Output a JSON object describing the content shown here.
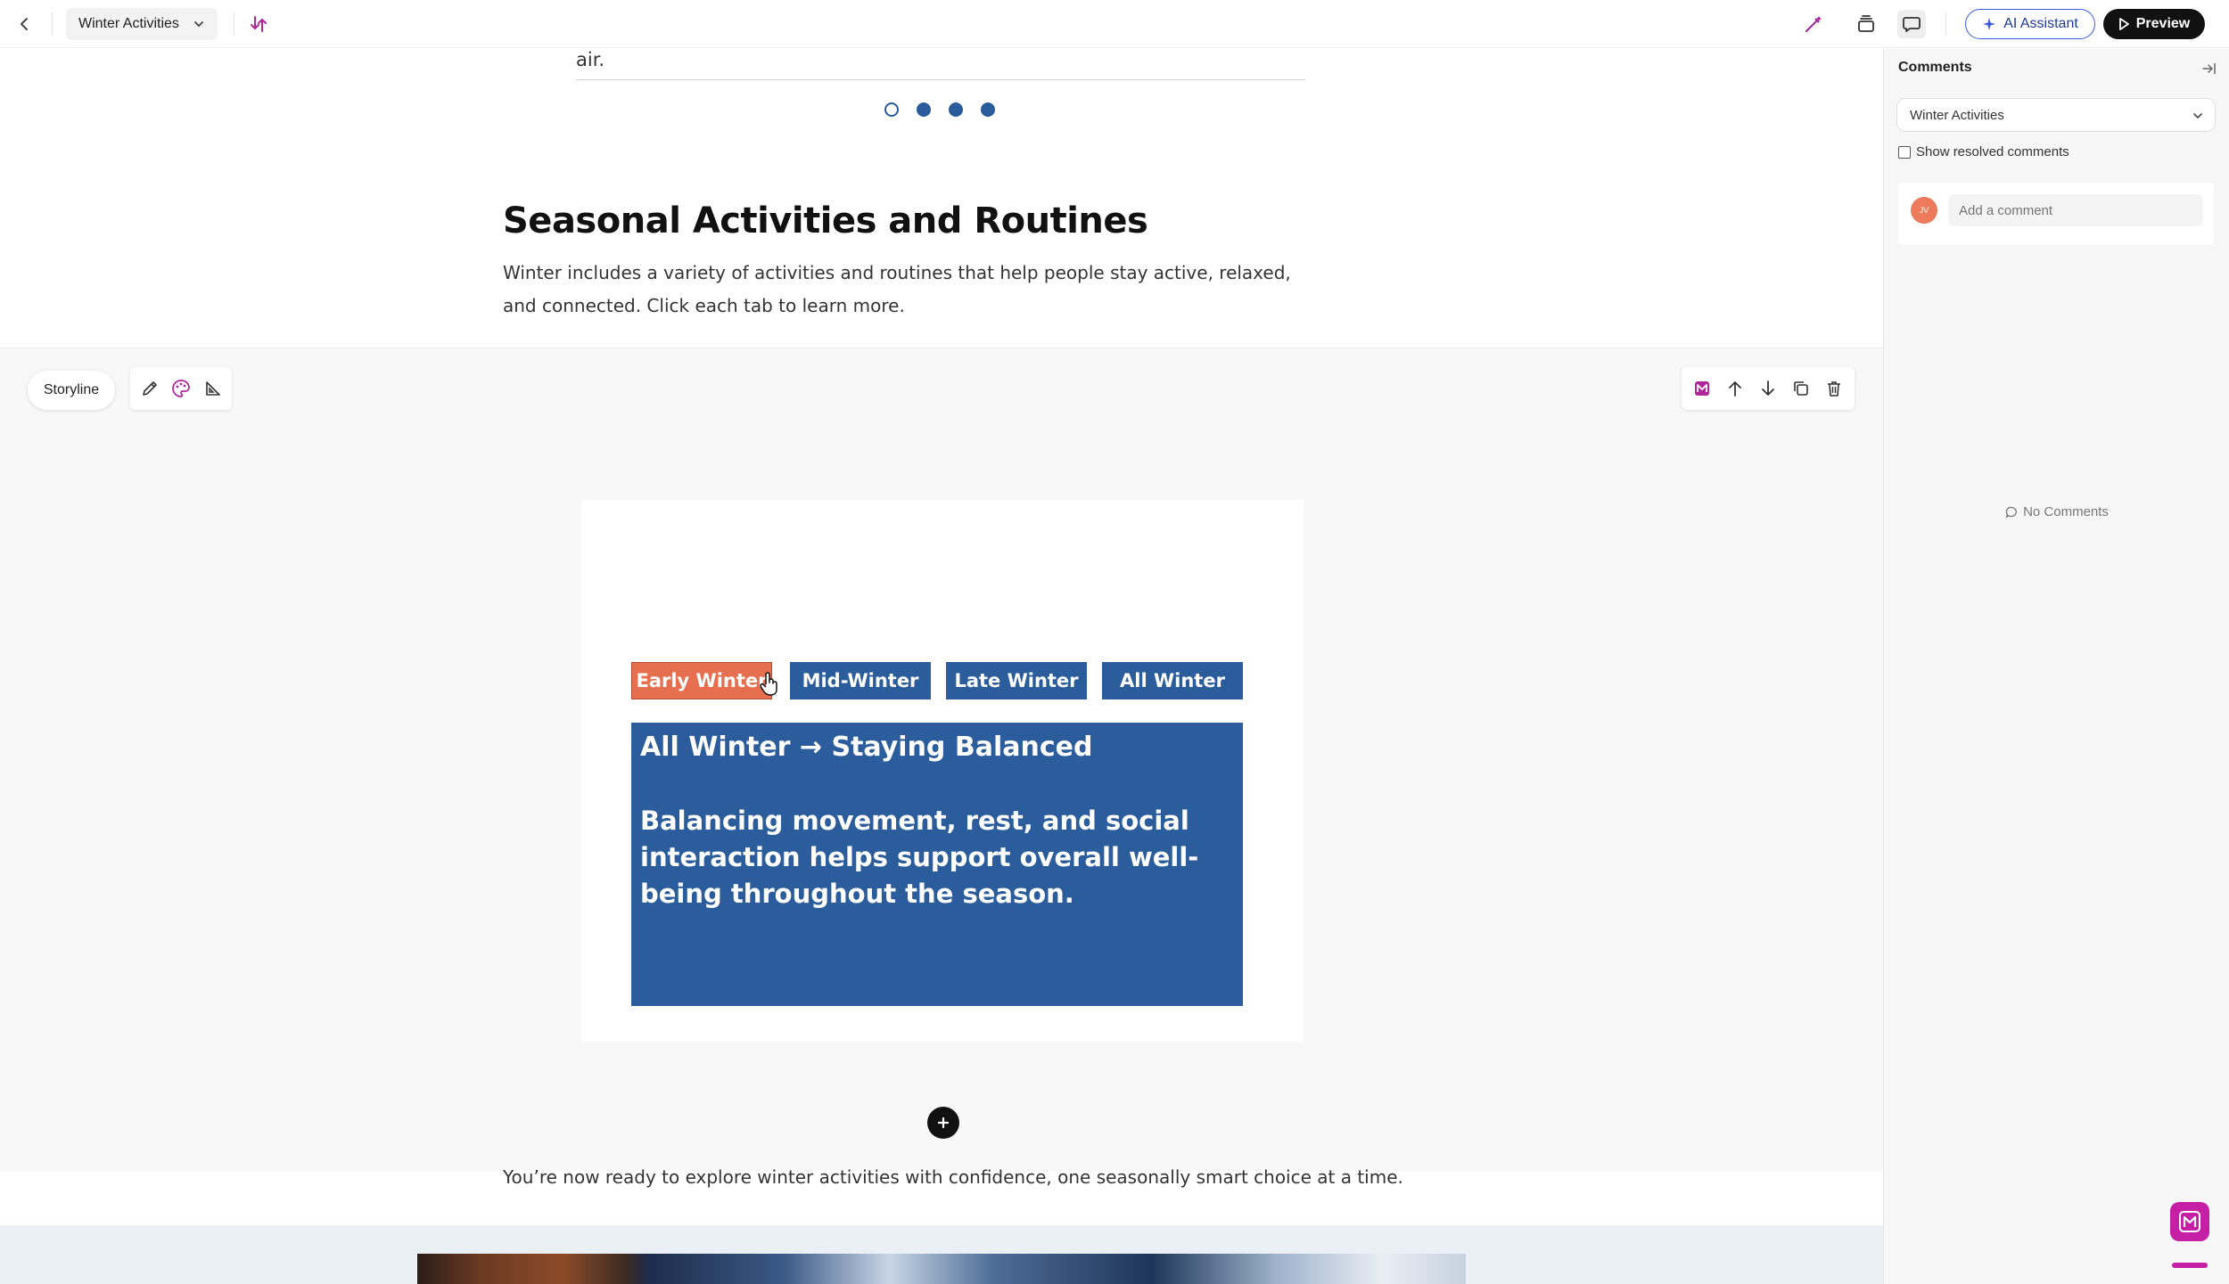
{
  "topbar": {
    "doc_title": "Winter Activities",
    "ai_assistant_label": "AI Assistant",
    "preview_label": "Preview"
  },
  "main": {
    "previous_text_tail": "air.",
    "carousel_dots": [
      "open",
      "filled",
      "filled",
      "filled"
    ],
    "section_title": "Seasonal Activities and Routines",
    "section_description": "Winter includes a variety of activities and routines that help people stay active, relaxed, and connected. Click each tab to learn more.",
    "block_toolbar": {
      "storyline_label": "Storyline"
    },
    "interaction": {
      "tabs": [
        {
          "label": "Early Winter",
          "active": true
        },
        {
          "label": "Mid-Winter",
          "active": false
        },
        {
          "label": "Late Winter",
          "active": false
        },
        {
          "label": "All Winter",
          "active": false
        }
      ],
      "panel_title": "All Winter → Staying Balanced",
      "panel_body": "Balancing movement, rest, and social interaction helps support overall well-being throughout the season."
    },
    "closing_text": "You’re now ready to explore winter activities with confidence, one seasonally smart choice at a time."
  },
  "comments_panel": {
    "title": "Comments",
    "filter_value": "Winter Activities",
    "show_resolved_label": "Show resolved comments",
    "avatar_initials": "JV",
    "add_comment_placeholder": "Add a comment",
    "empty_state": "No Comments"
  },
  "colors": {
    "tab_blue": "#2b5d9c",
    "tab_active": "#e56f4f",
    "brand": "#c51fa6",
    "ai_border": "#3b5bdb"
  }
}
